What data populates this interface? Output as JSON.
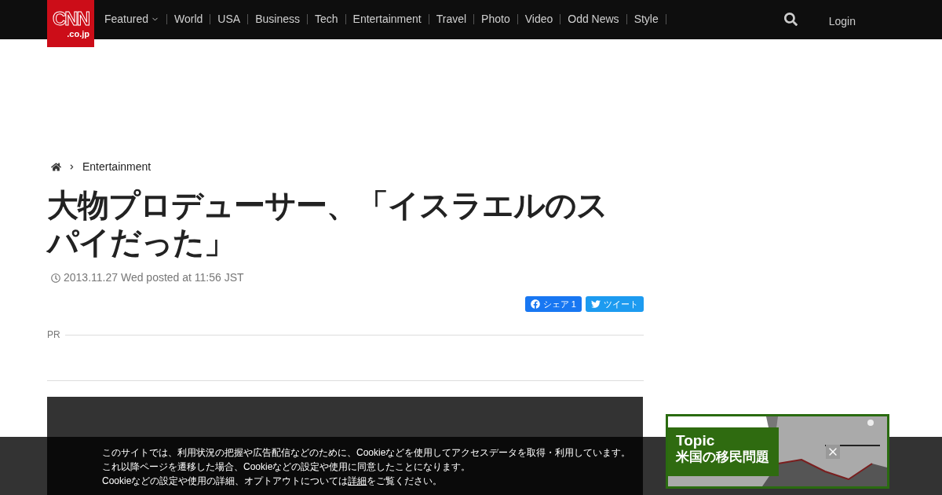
{
  "header": {
    "logo": {
      "main": "CNN",
      "sub": ".co.jp"
    },
    "nav": [
      {
        "label": "Featured",
        "dropdown": true
      },
      {
        "label": "World",
        "dropdown": false
      },
      {
        "label": "USA",
        "dropdown": false
      },
      {
        "label": "Business",
        "dropdown": false
      },
      {
        "label": "Tech",
        "dropdown": false
      },
      {
        "label": "Entertainment",
        "dropdown": false
      },
      {
        "label": "Travel",
        "dropdown": false
      },
      {
        "label": "Photo",
        "dropdown": false
      },
      {
        "label": "Video",
        "dropdown": false
      },
      {
        "label": "Odd News",
        "dropdown": false
      },
      {
        "label": "Style",
        "dropdown": false
      }
    ],
    "login": "Login"
  },
  "breadcrumb": [
    "Entertainment"
  ],
  "article": {
    "title": "大物プロデューサー、「イスラエルのスパイだった」",
    "date": "2013.11.27 Wed posted at 11:56 JST",
    "share": [
      {
        "kind": "facebook",
        "label": "シェア 1"
      },
      {
        "kind": "twitter",
        "label": "ツイート"
      }
    ],
    "pr_label": "PR"
  },
  "sidebar": {
    "topic": {
      "label": "Topic",
      "title": "米国の移民問題"
    }
  },
  "cookie_notice": {
    "lines": [
      "このサイトでは、利用状況の把握や広告配信などのために、Cookieなどを使用してアクセスデータを取得・利用しています。",
      "これ以降ページを遷移した場合、Cookieなどの設定や使用に同意したことになります。"
    ],
    "last_line": {
      "before": "Cookieなどの設定や使用の詳細、オプトアウトについては",
      "link": "詳細",
      "after": "をご覧ください。"
    }
  }
}
